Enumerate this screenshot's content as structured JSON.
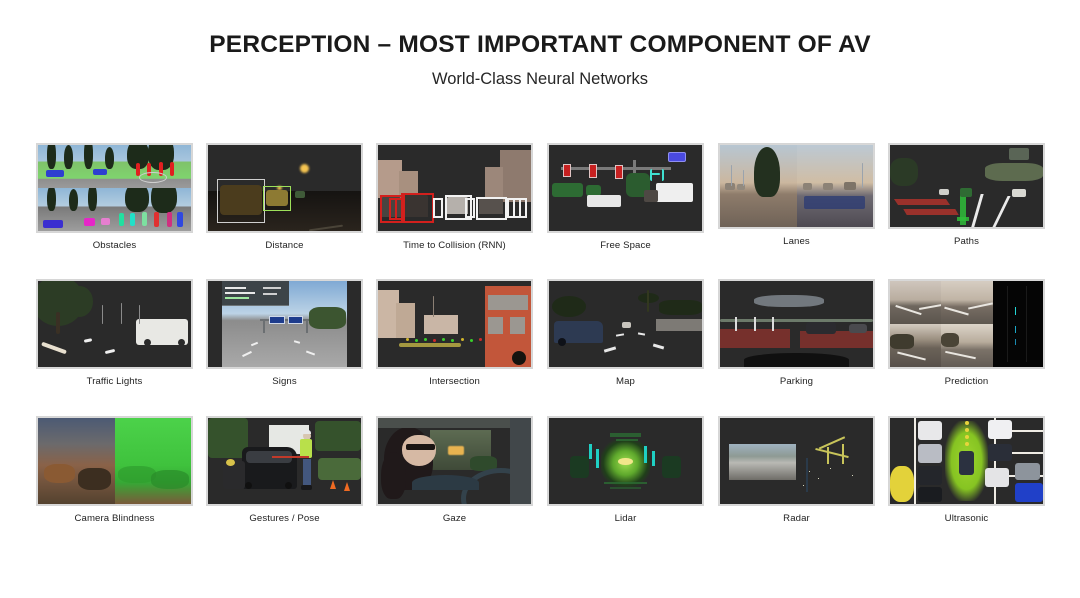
{
  "header": {
    "title": "PERCEPTION – MOST IMPORTANT COMPONENT OF AV",
    "subtitle": "World-Class Neural Networks"
  },
  "colors": {
    "background": "#ffffff",
    "title_text": "#1a1a1a",
    "caption_text": "#1f1f1f",
    "thumb_border": "#d6d6d6"
  },
  "grid": {
    "columns": 6,
    "rows": 3,
    "tiles": [
      {
        "id": "obstacles",
        "label": "Obstacles",
        "row": 0,
        "col": 0
      },
      {
        "id": "distance",
        "label": "Distance",
        "row": 0,
        "col": 1
      },
      {
        "id": "time-to-collision",
        "label": "Time to Collision (RNN)",
        "row": 0,
        "col": 2
      },
      {
        "id": "free-space",
        "label": "Free Space",
        "row": 0,
        "col": 3
      },
      {
        "id": "lanes",
        "label": "Lanes",
        "row": 0,
        "col": 4
      },
      {
        "id": "paths",
        "label": "Paths",
        "row": 0,
        "col": 5
      },
      {
        "id": "traffic-lights",
        "label": "Traffic Lights",
        "row": 1,
        "col": 0
      },
      {
        "id": "signs",
        "label": "Signs",
        "row": 1,
        "col": 1
      },
      {
        "id": "intersection",
        "label": "Intersection",
        "row": 1,
        "col": 2
      },
      {
        "id": "map",
        "label": "Map",
        "row": 1,
        "col": 3
      },
      {
        "id": "parking",
        "label": "Parking",
        "row": 1,
        "col": 4
      },
      {
        "id": "prediction",
        "label": "Prediction",
        "row": 1,
        "col": 5
      },
      {
        "id": "camera-blindness",
        "label": "Camera Blindness",
        "row": 2,
        "col": 0
      },
      {
        "id": "gestures-pose",
        "label": "Gestures / Pose",
        "row": 2,
        "col": 1
      },
      {
        "id": "gaze",
        "label": "Gaze",
        "row": 2,
        "col": 2
      },
      {
        "id": "lidar",
        "label": "Lidar",
        "row": 2,
        "col": 3
      },
      {
        "id": "radar",
        "label": "Radar",
        "row": 2,
        "col": 4
      },
      {
        "id": "ultrasonic",
        "label": "Ultrasonic",
        "row": 2,
        "col": 5
      }
    ]
  }
}
